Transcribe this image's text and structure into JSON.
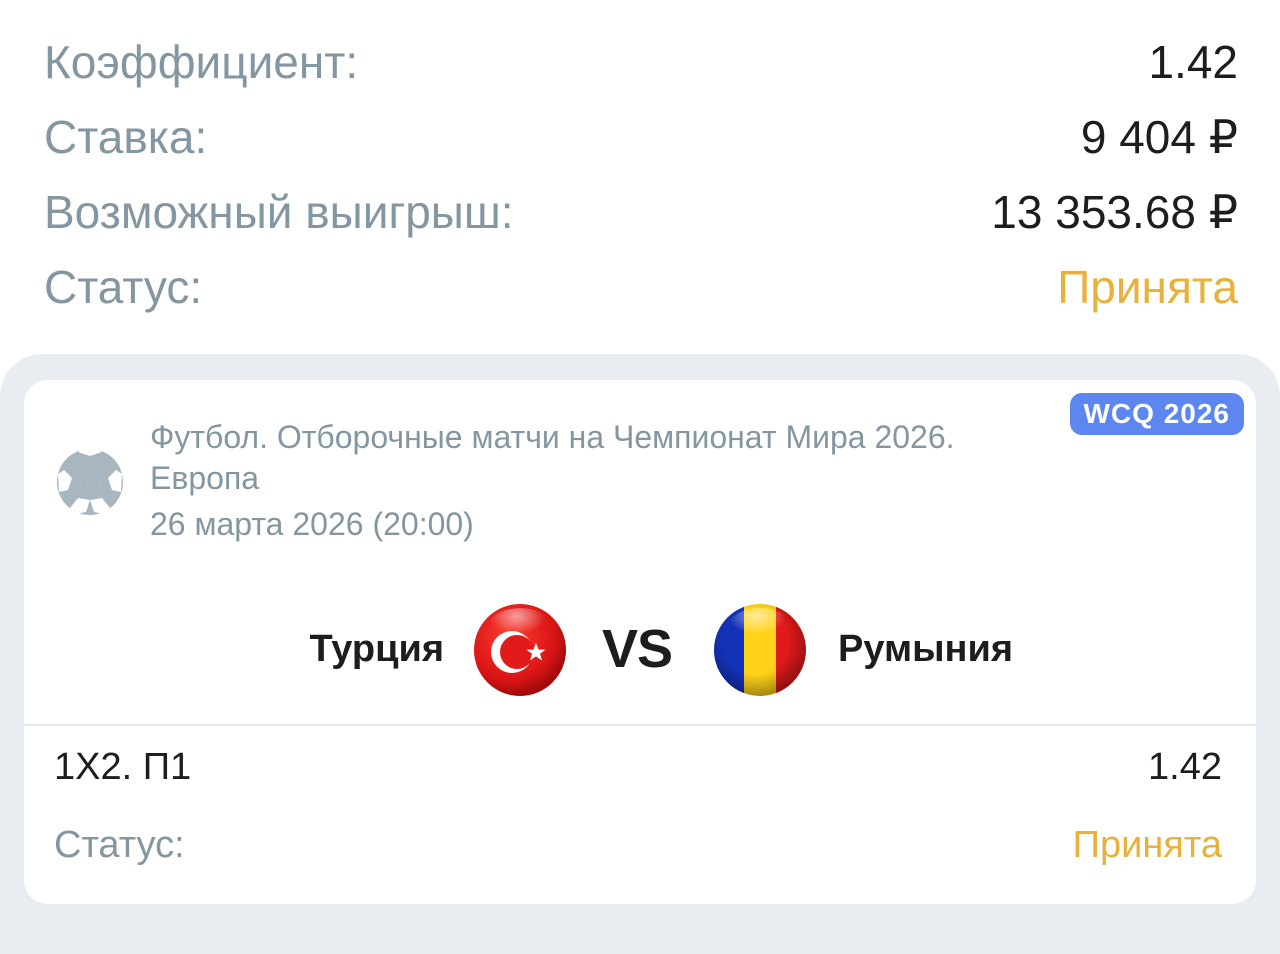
{
  "summary": {
    "coefficient_label": "Коэффициент:",
    "coefficient_value": "1.42",
    "stake_label": "Ставка:",
    "stake_value": "9 404 ₽",
    "possible_win_label": "Возможный выигрыш:",
    "possible_win_value": "13 353.68 ₽",
    "status_label": "Статус:",
    "status_value": "Принята"
  },
  "event": {
    "badge": "WCQ 2026",
    "sport_icon": "soccer-ball-icon",
    "title": "Футбол. Отборочные матчи на Чемпионат Мира 2026. Европа",
    "date": "26 марта 2026 (20:00)",
    "home_team": "Турция",
    "home_flag": "turkey-flag-icon",
    "vs": "VS",
    "away_team": "Румыния",
    "away_flag": "romania-flag-icon"
  },
  "bet": {
    "outcome": "1Х2. П1",
    "odds": "1.42",
    "status_label": "Статус:",
    "status_value": "Принята"
  },
  "colors": {
    "label_gray": "#8496a1",
    "status_yellow": "#e8b23a",
    "badge_blue": "#5e86f0",
    "panel_bg": "#e9edf2"
  }
}
